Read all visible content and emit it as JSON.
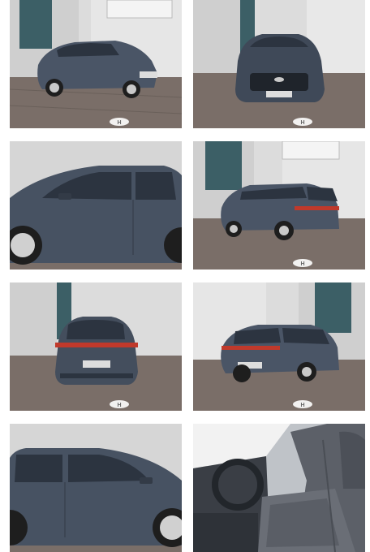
{
  "gallery": {
    "photos": [
      {
        "view": "front-three-quarter-left",
        "has_logo": true
      },
      {
        "view": "front",
        "has_logo": true
      },
      {
        "view": "side-left-closeup",
        "has_logo": false
      },
      {
        "view": "rear-three-quarter-left",
        "has_logo": true
      },
      {
        "view": "rear",
        "has_logo": true
      },
      {
        "view": "rear-three-quarter-right",
        "has_logo": true
      },
      {
        "view": "side-right-closeup",
        "has_logo": false
      },
      {
        "view": "interior-front-seats",
        "has_logo": false
      }
    ],
    "colors": {
      "car_body": "#4a5566",
      "car_dark": "#2c3440",
      "wall": "#d9d9d9",
      "wall_shadow": "#bfbfbf",
      "door_teal": "#3c5f66",
      "pavement": "#7a6e68",
      "taillight": "#c0392b",
      "seat": "#5c6068"
    }
  }
}
